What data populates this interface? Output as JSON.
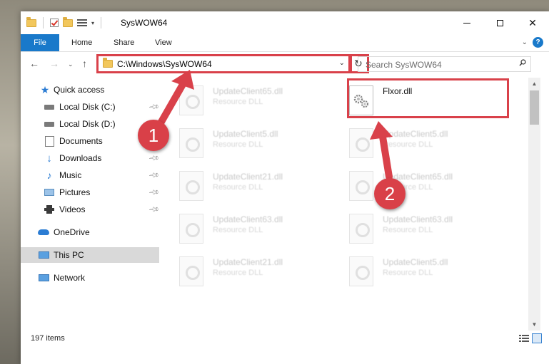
{
  "window": {
    "title": "SysWOW64"
  },
  "ribbon": {
    "tabs": [
      "File",
      "Home",
      "Share",
      "View"
    ],
    "help_label": "?"
  },
  "nav": {
    "address": "C:\\Windows\\SysWOW64",
    "search_placeholder": "Search SysWOW64"
  },
  "sidebar": {
    "items": [
      {
        "label": "Quick access",
        "icon": "star-icon"
      },
      {
        "label": "Local Disk (C:)",
        "icon": "drive-icon",
        "pinned": true
      },
      {
        "label": "Local Disk (D:)",
        "icon": "drive-icon"
      },
      {
        "label": "Documents",
        "icon": "documents-icon",
        "pinned": true
      },
      {
        "label": "Downloads",
        "icon": "download-arrow-icon",
        "pinned": true
      },
      {
        "label": "Music",
        "icon": "music-note-icon",
        "pinned": true
      },
      {
        "label": "Pictures",
        "icon": "pictures-icon",
        "pinned": true
      },
      {
        "label": "Videos",
        "icon": "film-icon",
        "pinned": true
      },
      {
        "label": "OneDrive",
        "icon": "cloud-icon"
      },
      {
        "label": "This PC",
        "icon": "monitor-icon",
        "selected": true
      },
      {
        "label": "Network",
        "icon": "network-icon"
      }
    ]
  },
  "files": {
    "highlighted": {
      "name": "Flxor.dll"
    },
    "left_column": [
      {
        "name": "UpdateClient65.dll",
        "type": "Resource DLL"
      },
      {
        "name": "UpdateClient5.dll",
        "type": "Resource DLL"
      },
      {
        "name": "UpdateClient21.dll",
        "type": "Resource DLL"
      },
      {
        "name": "UpdateClient63.dll",
        "type": "Resource DLL"
      },
      {
        "name": "UpdateClient21.dll",
        "type": "Resource DLL"
      }
    ],
    "right_column": [
      {
        "name": "UpdateClient5.dll",
        "type": "Resource DLL"
      },
      {
        "name": "UpdateClient65.dll",
        "type": "Resource DLL"
      },
      {
        "name": "UpdateClient63.dll",
        "type": "Resource DLL"
      },
      {
        "name": "UpdateClient5.dll",
        "type": "Resource DLL"
      }
    ]
  },
  "status": {
    "items_count": "197 items"
  },
  "annotations": {
    "step1": "1",
    "step2": "2",
    "color": "#d9414a"
  },
  "colors": {
    "accent": "#1979ca",
    "highlight": "#d9414a",
    "folder": "#f2c75c"
  }
}
